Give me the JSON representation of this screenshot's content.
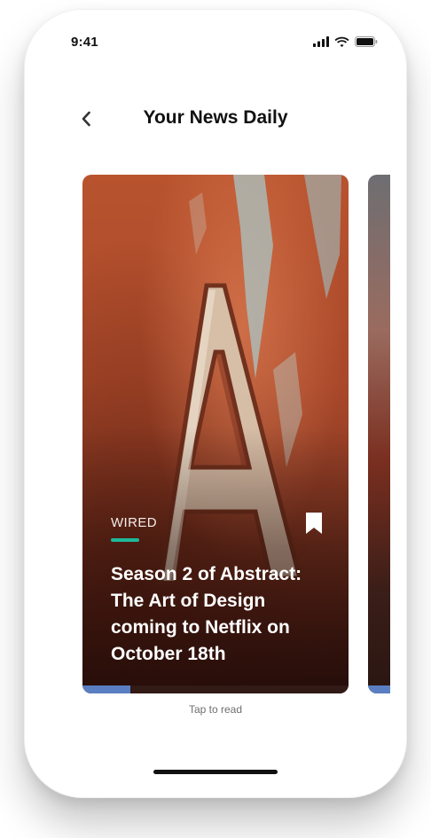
{
  "status_bar": {
    "time": "9:41",
    "icons": [
      "signal-icon",
      "wifi-icon",
      "battery-icon"
    ]
  },
  "nav": {
    "back_icon": "chevron-left-icon",
    "title": "Your News Daily"
  },
  "cards": [
    {
      "source": "WIRED",
      "headline": "Season 2 of Abstract: The Art of Design coming to Netflix on October 18th",
      "bookmark_icon": "bookmark-icon",
      "progress_fraction": 0.18,
      "image_description_icon": "letter-a-photo"
    }
  ],
  "tap_hint": "Tap to read",
  "colors": {
    "accent_teal": "#1fb99a",
    "progress_blue": "#5a7ec2",
    "text_dark": "#111111"
  }
}
